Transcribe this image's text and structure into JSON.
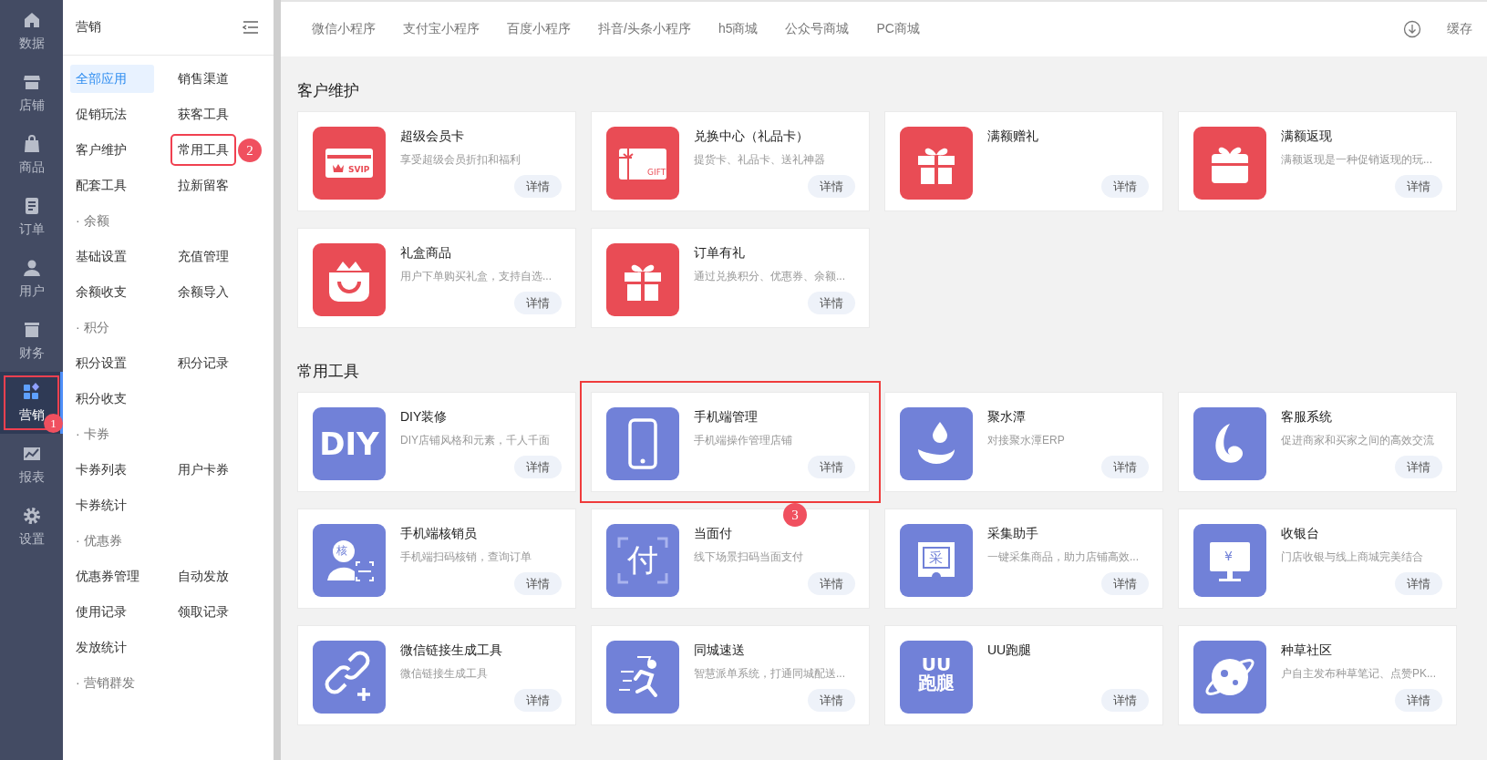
{
  "nav": [
    {
      "label": "数据",
      "kind": "home",
      "selected": false
    },
    {
      "label": "店铺",
      "kind": "store",
      "selected": false
    },
    {
      "label": "商品",
      "kind": "bag",
      "selected": false
    },
    {
      "label": "订单",
      "kind": "doc",
      "selected": false
    },
    {
      "label": "用户",
      "kind": "user",
      "selected": false
    },
    {
      "label": "财务",
      "kind": "money",
      "selected": false
    },
    {
      "label": "营销",
      "kind": "apps",
      "selected": true,
      "highlighted": true,
      "badge": "1"
    },
    {
      "label": "报表",
      "kind": "chart",
      "selected": false
    },
    {
      "label": "设置",
      "kind": "gear",
      "selected": false
    }
  ],
  "submenu": {
    "title": "营销",
    "groups": [
      {
        "items": [
          {
            "label": "全部应用",
            "selected": true
          },
          {
            "label": "销售渠道",
            "selected": false
          },
          {
            "label": "促销玩法",
            "selected": false
          },
          {
            "label": "获客工具",
            "selected": false
          },
          {
            "label": "客户维护",
            "selected": false
          },
          {
            "label": "常用工具",
            "selected": false,
            "highlighted": true,
            "badge": "2"
          },
          {
            "label": "配套工具",
            "selected": false
          },
          {
            "label": "拉新留客",
            "selected": false
          }
        ]
      },
      {
        "heading": "· 余额",
        "items": [
          {
            "label": "基础设置",
            "selected": false
          },
          {
            "label": "充值管理",
            "selected": false
          },
          {
            "label": "余额收支",
            "selected": false
          },
          {
            "label": "余额导入",
            "selected": false
          }
        ]
      },
      {
        "heading": "· 积分",
        "items": [
          {
            "label": "积分设置",
            "selected": false
          },
          {
            "label": "积分记录",
            "selected": false
          },
          {
            "label": "积分收支",
            "selected": false
          }
        ]
      },
      {
        "heading": "· 卡券",
        "items": [
          {
            "label": "卡券列表",
            "selected": false
          },
          {
            "label": "用户卡券",
            "selected": false
          },
          {
            "label": "卡券统计",
            "selected": false
          }
        ]
      },
      {
        "heading": "· 优惠券",
        "items": [
          {
            "label": "优惠券管理",
            "selected": false
          },
          {
            "label": "自动发放",
            "selected": false
          },
          {
            "label": "使用记录",
            "selected": false
          },
          {
            "label": "领取记录",
            "selected": false
          },
          {
            "label": "发放统计",
            "selected": false
          }
        ]
      },
      {
        "heading": "· 营销群发"
      }
    ]
  },
  "top_tabs": [
    "微信小程序",
    "支付宝小程序",
    "百度小程序",
    "抖音/头条小程序",
    "h5商城",
    "公众号商城",
    "PC商城"
  ],
  "cache_label": "缓存",
  "sections": [
    {
      "title": "客户维护",
      "cards": [
        {
          "title": "超级会员卡",
          "desc": "享受超级会员折扣和福利",
          "kind": "svip",
          "icon_text": "SVIP",
          "color": "#e94c55",
          "action": "详情"
        },
        {
          "title": "兑换中心（礼品卡）",
          "desc": "提货卡、礼品卡、送礼神器",
          "kind": "giftcard",
          "icon_text": "GIFT",
          "color": "#e94c55",
          "action": "详情"
        },
        {
          "title": "满额赠礼",
          "kind": "gift",
          "color": "#e94c55",
          "action": "详情"
        },
        {
          "title": "满额返现",
          "desc": "满额返现是一种促销返现的玩...",
          "kind": "giftbox",
          "color": "#e94c55",
          "action": "详情"
        },
        {
          "title": "礼盒商品",
          "desc": "用户下单购买礼盒，支持自选...",
          "kind": "bag",
          "color": "#e94c55",
          "action": "详情"
        },
        {
          "title": "订单有礼",
          "desc": "通过兑换积分、优惠券、余额...",
          "kind": "gift",
          "color": "#e94c55",
          "action": "详情"
        }
      ]
    },
    {
      "title": "常用工具",
      "cards": [
        {
          "title": "DIY装修",
          "desc": "DIY店铺风格和元素，千人千面",
          "kind": "text",
          "icon_text": "DIY",
          "color": "#7181d8",
          "action": "详情"
        },
        {
          "title": "手机端管理",
          "desc": "手机端操作管理店铺",
          "kind": "phone",
          "color": "#7181d8",
          "action": "详情",
          "highlighted": true,
          "badge": "3"
        },
        {
          "title": "聚水潭",
          "desc": "对接聚水潭ERP",
          "kind": "drop",
          "color": "#7181d8",
          "action": "详情"
        },
        {
          "title": "客服系统",
          "desc": "促进商家和买家之间的高效交流",
          "kind": "swirl",
          "color": "#7181d8",
          "action": "详情"
        },
        {
          "title": "手机端核销员",
          "desc": "手机端扫码核销，查询订单",
          "kind": "person",
          "icon_text": "核",
          "color": "#7181d8",
          "action": "详情"
        },
        {
          "title": "当面付",
          "desc": "线下场景扫码当面支付",
          "kind": "frame",
          "icon_text": "付",
          "color": "#7181d8",
          "action": "详情"
        },
        {
          "title": "采集助手",
          "desc": "一键采集商品，助力店铺高效...",
          "kind": "collect",
          "icon_text": "采",
          "color": "#7181d8",
          "action": "详情"
        },
        {
          "title": "收银台",
          "desc": "门店收银与线上商城完美结合",
          "kind": "monitor",
          "icon_text": "¥",
          "color": "#7181d8",
          "action": "详情"
        },
        {
          "title": "微信链接生成工具",
          "desc": "微信链接生成工具",
          "kind": "link",
          "color": "#7181d8",
          "action": "详情"
        },
        {
          "title": "同城速送",
          "desc": "智慧派单系统，打通同城配送...",
          "kind": "runner",
          "color": "#7181d8",
          "action": "详情"
        },
        {
          "title": "UU跑腿",
          "kind": "text",
          "icon_text": "UU 跑腿",
          "color": "#7181d8",
          "action": "详情"
        },
        {
          "title": "种草社区",
          "desc": "户自主发布种草笔记、点赞PK...",
          "kind": "planet",
          "color": "#7181d8",
          "action": "详情"
        }
      ]
    }
  ]
}
